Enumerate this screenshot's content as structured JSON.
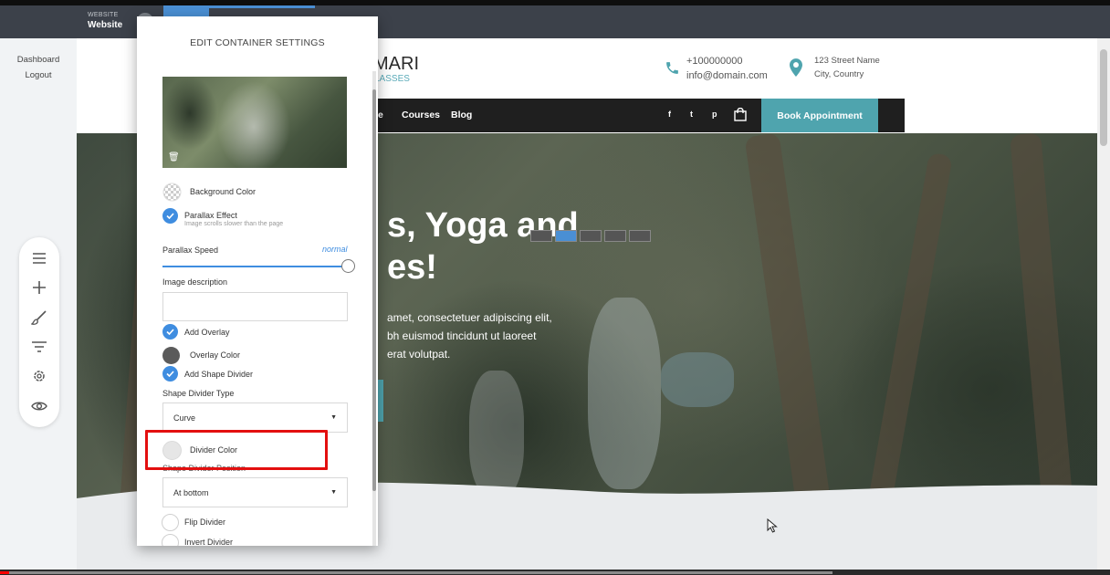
{
  "topbar": {
    "website_label": "WEBSITE",
    "website_name": "Website"
  },
  "leftnav": {
    "items": [
      {
        "label": "Dashboard"
      },
      {
        "label": "Logout"
      }
    ]
  },
  "toolbox": {
    "icons": [
      "menu-icon",
      "plus-icon",
      "brush-icon",
      "filter-icon",
      "gear-icon",
      "eye-icon"
    ]
  },
  "site": {
    "logo_title": "MARI",
    "logo_subtitle": "LASSES",
    "phone": "+100000000",
    "email": "info@domain.com",
    "address_line1": "123 Street Name",
    "address_line2": "City, Country",
    "nav": [
      {
        "label": "e"
      },
      {
        "label": "Courses"
      },
      {
        "label": "Blog"
      }
    ],
    "social": [
      "f",
      "t",
      "p"
    ],
    "book_label": "Book Appointment",
    "hero_title_line1": "s, Yoga and",
    "hero_title_line2": "es!",
    "hero_text_line1": "amet, consectetuer adipiscing elit,",
    "hero_text_line2": "bh euismod tincidunt ut laoreet",
    "hero_text_line3": "erat volutpat."
  },
  "panel": {
    "title": "EDIT CONTAINER SETTINGS",
    "background_color_label": "Background Color",
    "parallax_label": "Parallax Effect",
    "parallax_sub": "Image scrolls slower than the page",
    "parallax_speed_label": "Parallax Speed",
    "parallax_speed_value": "normal",
    "parallax_speed_level": 1.0,
    "image_description_label": "Image description",
    "image_description_value": "",
    "add_overlay_label": "Add Overlay",
    "overlay_color_label": "Overlay Color",
    "add_shape_divider_label": "Add Shape Divider",
    "shape_divider_type_label": "Shape Divider Type",
    "shape_divider_type_value": "Curve",
    "divider_color_label": "Divider Color",
    "shape_divider_position_label": "Shape Divider Position",
    "shape_divider_position_value": "At bottom",
    "flip_divider_label": "Flip Divider",
    "invert_divider_label": "Invert Divider"
  },
  "colors": {
    "accent_blue": "#3f8de0",
    "brand_teal": "#4fa4ae",
    "highlight_red": "#e30f0f",
    "overlay_color": "#5b5b5b",
    "divider_color": "#e6e6e6"
  },
  "video": {
    "progress": 0.008,
    "buffered": 0.75
  }
}
